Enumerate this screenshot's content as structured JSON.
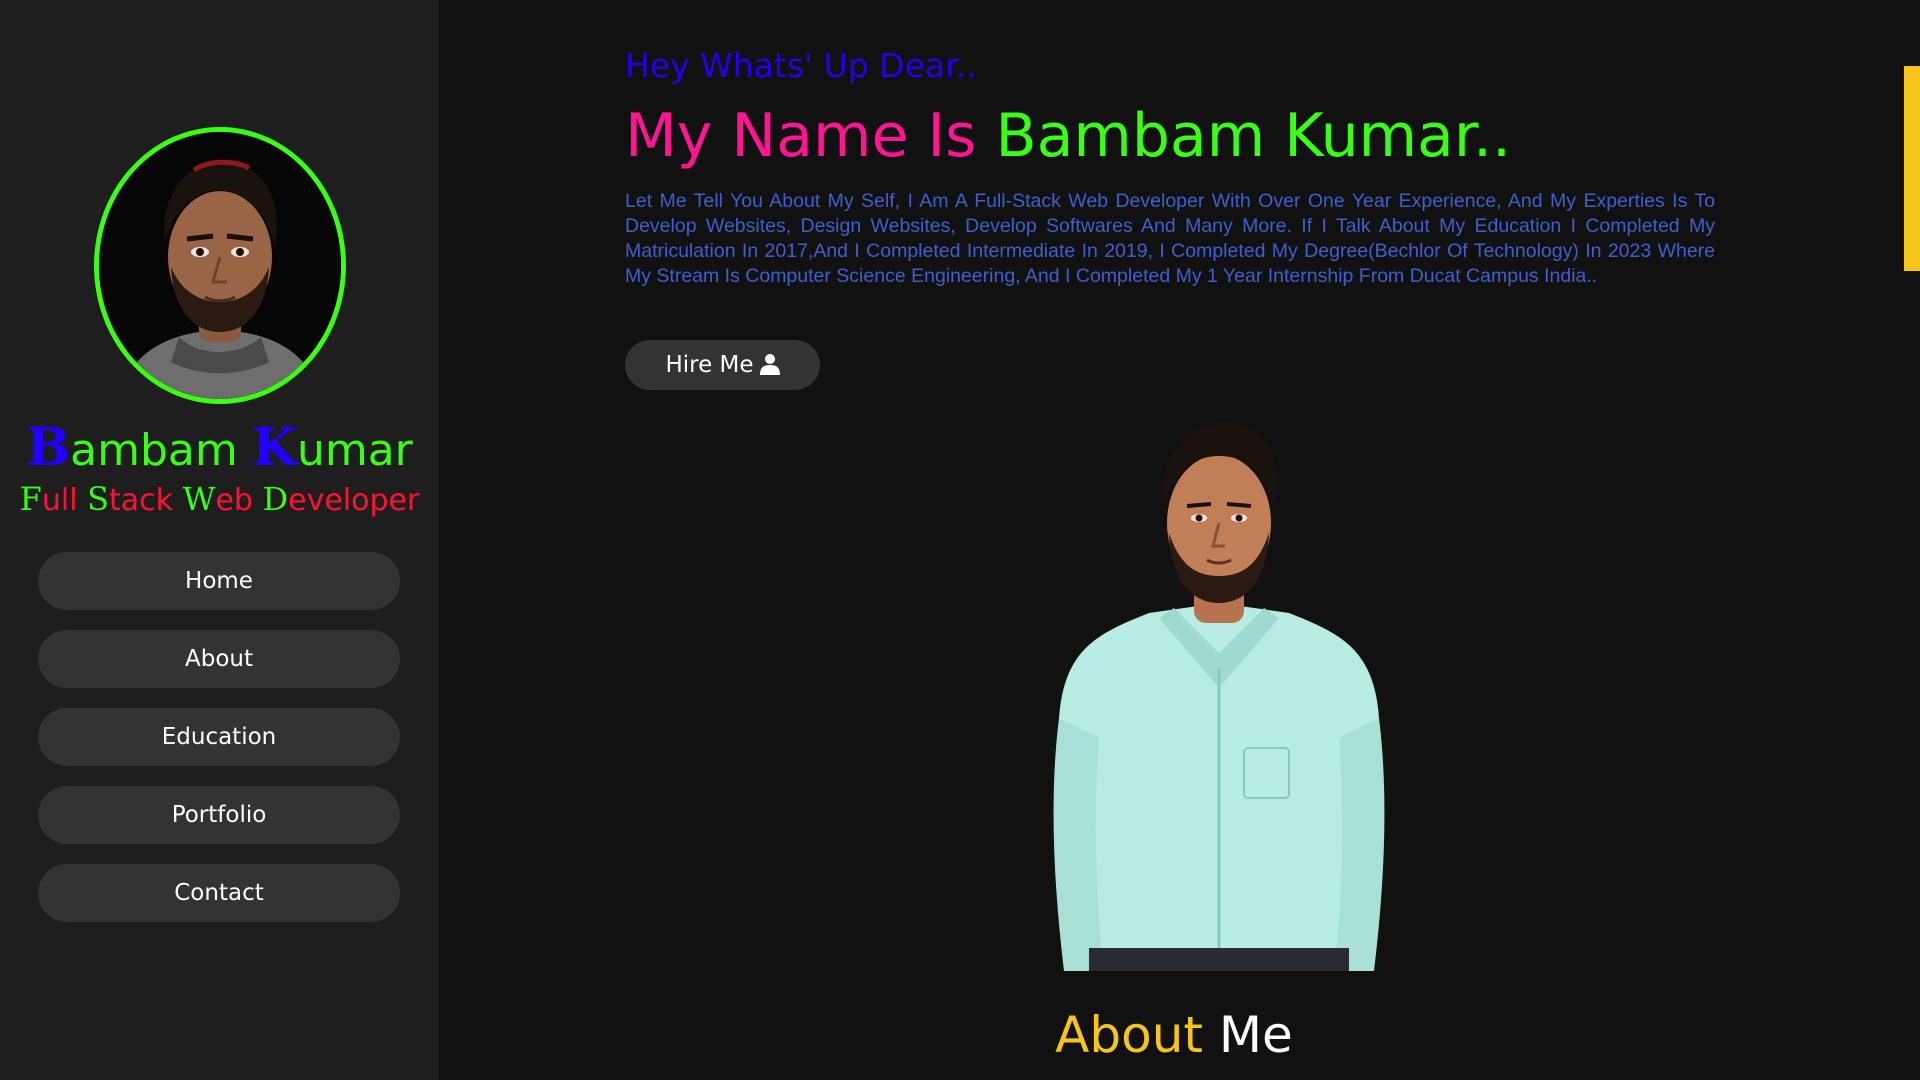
{
  "sidebar": {
    "brand": {
      "first_initial": "B",
      "first_rest": "ambam",
      "last_initial": "K",
      "last_rest": "umar"
    },
    "role": {
      "w1_initial": "F",
      "w1_rest": "ull",
      "w2_initial": "S",
      "w2_rest": "tack",
      "w3_initial": "W",
      "w3_rest": "eb",
      "w4_initial": "D",
      "w4_rest": "eveloper"
    },
    "nav": [
      {
        "label": "Home"
      },
      {
        "label": "About"
      },
      {
        "label": "Education"
      },
      {
        "label": "Portfolio"
      },
      {
        "label": "Contact"
      }
    ]
  },
  "main": {
    "greeting": "Hey Whats' Up Dear..",
    "headline": {
      "part_a": "My Name Is",
      "part_b": "Bambam Kumar.."
    },
    "bio": "Let Me Tell You About My Self, I Am A Full-Stack Web Developer With Over One Year Experience, And My Experties Is To Develop Websites, Design Websites, Develop Softwares And Many More. If I Talk About My Education I Completed My Matriculation In 2017,And I Completed Intermediate In 2019, I Completed My Degree(Bechlor Of Technology) In 2023 Where My Stream Is Computer Science Engineering, And I Completed My 1 Year Internship From Ducat Campus India..",
    "hire_label": "Hire Me",
    "hire_icon": "user-icon",
    "about_title": {
      "part_a": "About",
      "part_b": "Me"
    }
  },
  "colors": {
    "background": "#111111",
    "sidebar": "#1e1e1e",
    "accent_green": "#39ff14",
    "accent_blue": "#2200ee",
    "accent_pink": "#ff1493",
    "accent_red": "#ff1133",
    "accent_yellow": "#f5c518",
    "button": "#333333"
  }
}
